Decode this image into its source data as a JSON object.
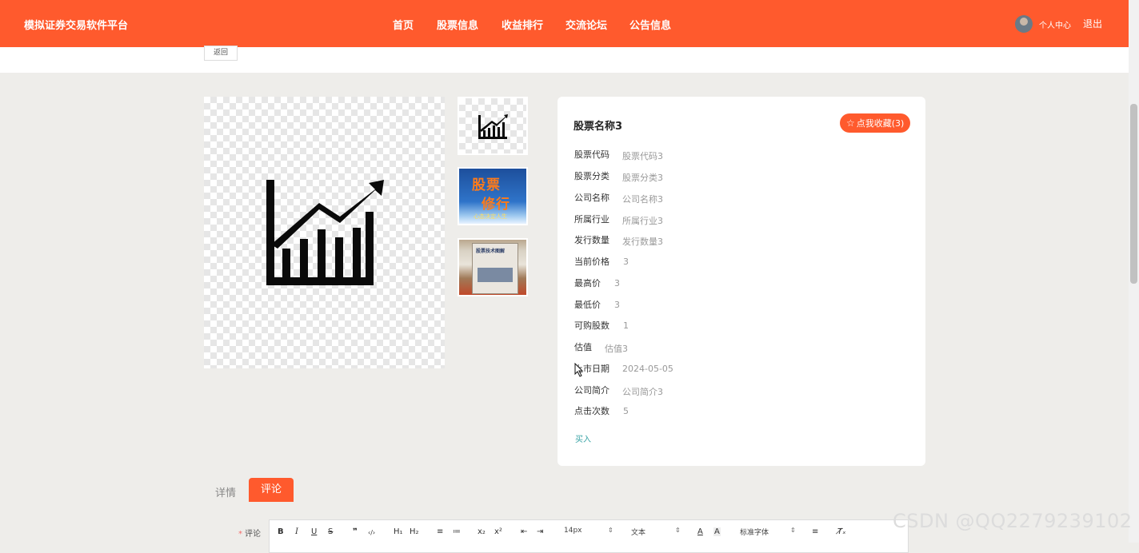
{
  "header": {
    "brand": "模拟证券交易软件平台",
    "nav": [
      {
        "label": "首页"
      },
      {
        "label": "股票信息"
      },
      {
        "label": "收益排行"
      },
      {
        "label": "交流论坛"
      },
      {
        "label": "公告信息"
      }
    ],
    "user_center": "个人中心",
    "logout": "退出",
    "accent_color": "#ff5a2d"
  },
  "back_button": "返回",
  "gallery": {
    "thumbs": [
      {
        "icon": "stock-chart-icon"
      },
      {
        "title_line1": "股票",
        "title_line2": "修行",
        "subtitle": "心态决定人生"
      },
      {
        "cover_text": "股票技术图解"
      }
    ]
  },
  "stock": {
    "title": "股票名称3",
    "favorite_label": "点我收藏(3)",
    "fields": [
      {
        "label": "股票代码",
        "value": "股票代码3"
      },
      {
        "label": "股票分类",
        "value": "股票分类3"
      },
      {
        "label": "公司名称",
        "value": "公司名称3"
      },
      {
        "label": "所属行业",
        "value": "所属行业3"
      },
      {
        "label": "发行数量",
        "value": "发行数量3"
      },
      {
        "label": "当前价格",
        "value": "3"
      },
      {
        "label": "最高价",
        "value": "3"
      },
      {
        "label": "最低价",
        "value": "3"
      },
      {
        "label": "可购股数",
        "value": "1"
      },
      {
        "label": "估值",
        "value": "估值3"
      },
      {
        "label": "上市日期",
        "value": "2024-05-05"
      },
      {
        "label": "公司简介",
        "value": "公司简介3"
      },
      {
        "label": "点击次数",
        "value": "5"
      }
    ],
    "buy_label": "买入"
  },
  "tabs": [
    {
      "label": "详情"
    },
    {
      "label": "评论"
    }
  ],
  "comment": {
    "required_mark": "*",
    "label": "评论",
    "toolbar": {
      "bold": "B",
      "italic": "I",
      "underline": "U",
      "strike": "S",
      "quote": "❞",
      "code": "‹/›",
      "h1": "H₁",
      "h2": "H₂",
      "ordered": "≡",
      "bullet": "≔",
      "sub": "x₂",
      "sup": "x²",
      "outdent": "⇤",
      "indent": "⇥",
      "font_size": "14px",
      "text_style": "文本",
      "font_family": "标准字体",
      "align": "≡",
      "clear": "T̸ₓ"
    }
  },
  "watermark": "CSDN @QQ2279239102"
}
